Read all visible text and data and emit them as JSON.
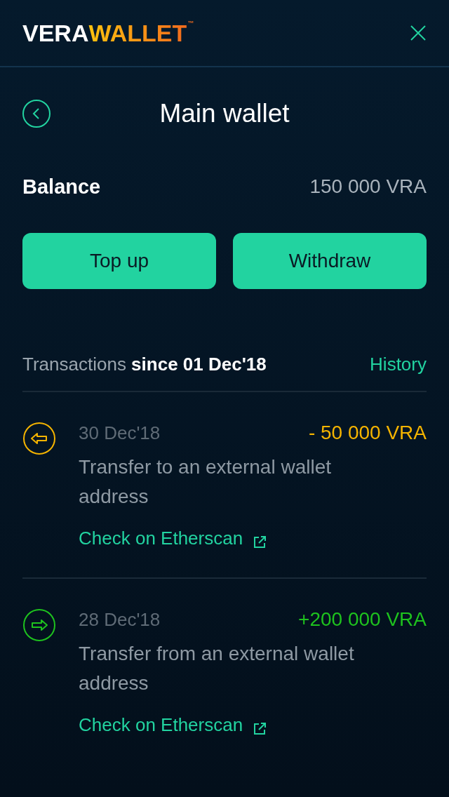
{
  "header": {
    "logo": {
      "first": "VERA",
      "second": "WALLET",
      "mark": "™"
    }
  },
  "title": "Main wallet",
  "balance": {
    "label": "Balance",
    "value": "150 000 VRA"
  },
  "actions": [
    "Top up",
    "Withdraw"
  ],
  "transactions_header": {
    "text": "Transactions **since 01 Dec'18**",
    "link": "History"
  },
  "transactions": [
    {
      "kind": "outgoing",
      "color": "#f5b400",
      "date": "30 Dec'18",
      "amount": "- 50 000 VRA",
      "description": "Transfer to an external wallet address",
      "link": "Check on Etherscan"
    },
    {
      "kind": "incoming",
      "color": "#1ec21e",
      "date": "28 Dec'18",
      "amount": "+200 000 VRA",
      "description": "Transfer from an external wallet address",
      "link": "Check on Etherscan"
    }
  ]
}
